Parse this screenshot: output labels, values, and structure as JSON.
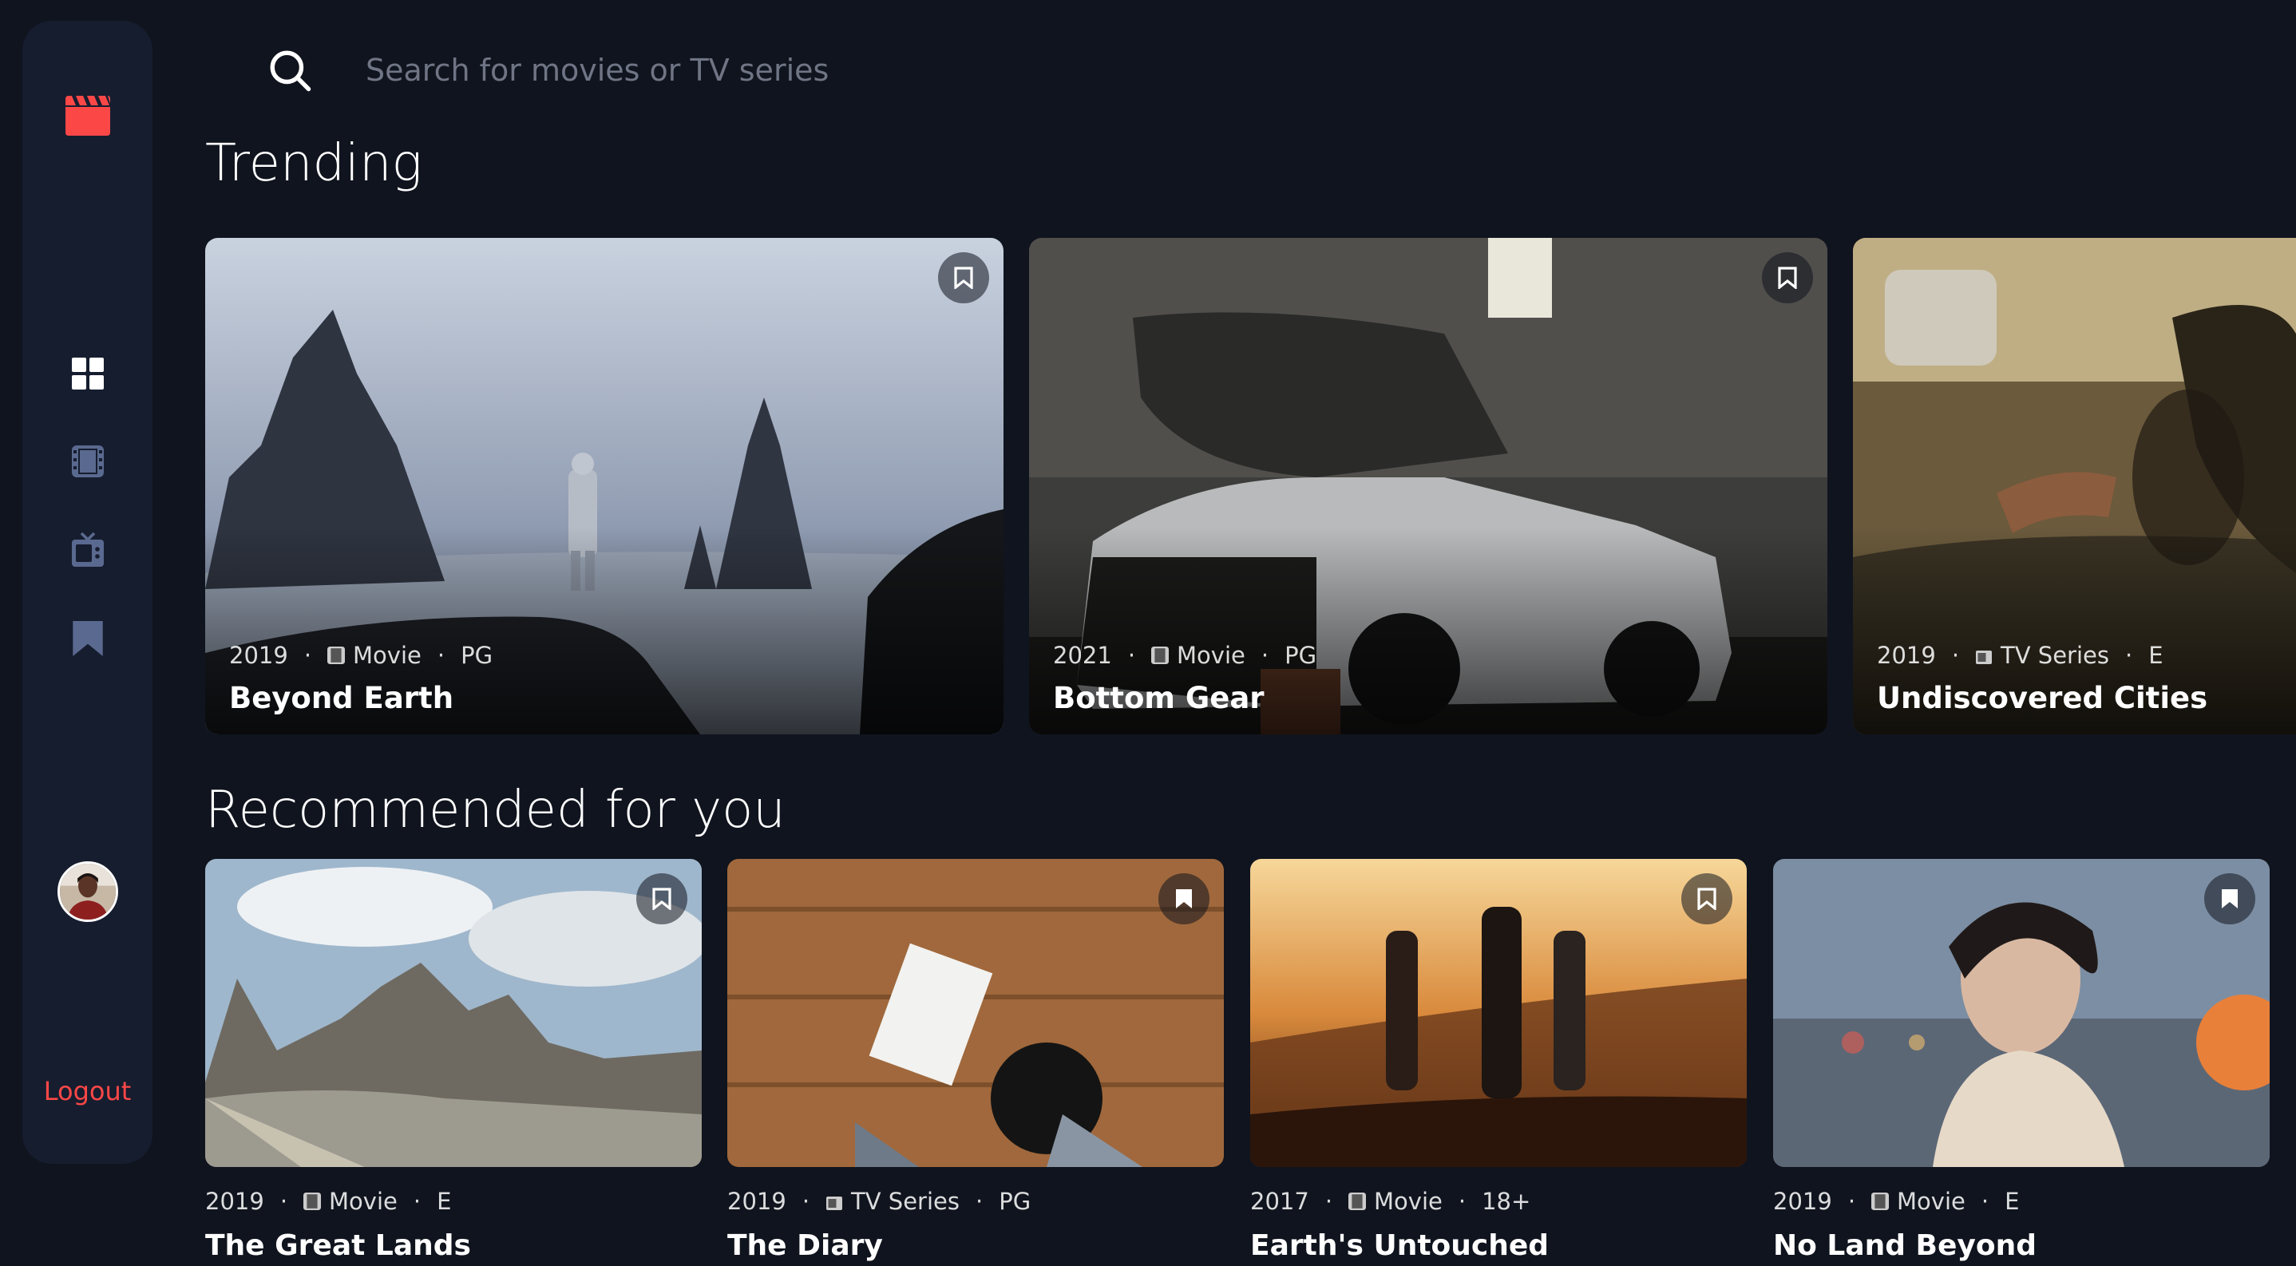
{
  "sidebar": {
    "logout_label": "Logout"
  },
  "search": {
    "placeholder": "Search for movies or TV series"
  },
  "sections": {
    "trending": "Trending",
    "recommended": "Recommended for you"
  },
  "trending": [
    {
      "year": "2019",
      "category": "Movie",
      "rating": "PG",
      "title": "Beyond Earth"
    },
    {
      "year": "2021",
      "category": "Movie",
      "rating": "PG",
      "title": "Bottom Gear"
    },
    {
      "year": "2019",
      "category": "TV Series",
      "rating": "E",
      "title": "Undiscovered Cities"
    }
  ],
  "recommended": [
    {
      "year": "2019",
      "category": "Movie",
      "rating": "E",
      "title": "The Great Lands"
    },
    {
      "year": "2019",
      "category": "TV Series",
      "rating": "PG",
      "title": "The Diary"
    },
    {
      "year": "2017",
      "category": "Movie",
      "rating": "18+",
      "title": "Earth's Untouched"
    },
    {
      "year": "2019",
      "category": "Movie",
      "rating": "E",
      "title": "No Land Beyond"
    }
  ],
  "colors": {
    "background": "#10141e",
    "sidebar": "#161d2f",
    "accent": "#fc4747",
    "icon": "#5a698f"
  }
}
